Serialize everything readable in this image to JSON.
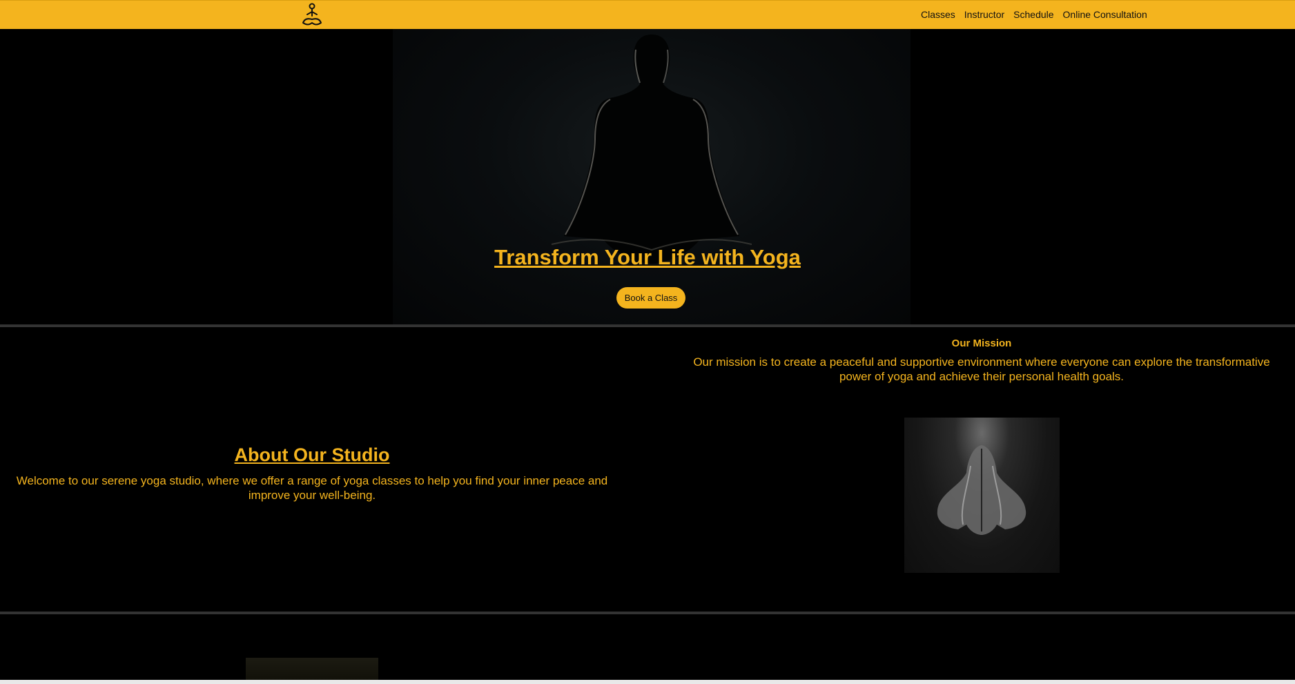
{
  "header": {
    "logo_icon": "meditation-figure-icon",
    "nav": [
      {
        "label": "Classes"
      },
      {
        "label": "Instructor"
      },
      {
        "label": "Schedule"
      },
      {
        "label": "Online Consultation"
      }
    ]
  },
  "hero": {
    "title": "Transform Your Life with Yoga",
    "cta_label": "Book a Class"
  },
  "about": {
    "heading": "About Our Studio",
    "text": "Welcome to our serene yoga studio, where we offer a range of yoga classes to help you find your inner peace and improve your well-being."
  },
  "mission": {
    "title": "Our Mission",
    "text": "Our mission is to create a peaceful and supportive environment where everyone can explore the transformative power of yoga and achieve their personal health goals."
  },
  "colors": {
    "accent": "#f4b41e",
    "background": "#000000",
    "divider": "#333333"
  }
}
